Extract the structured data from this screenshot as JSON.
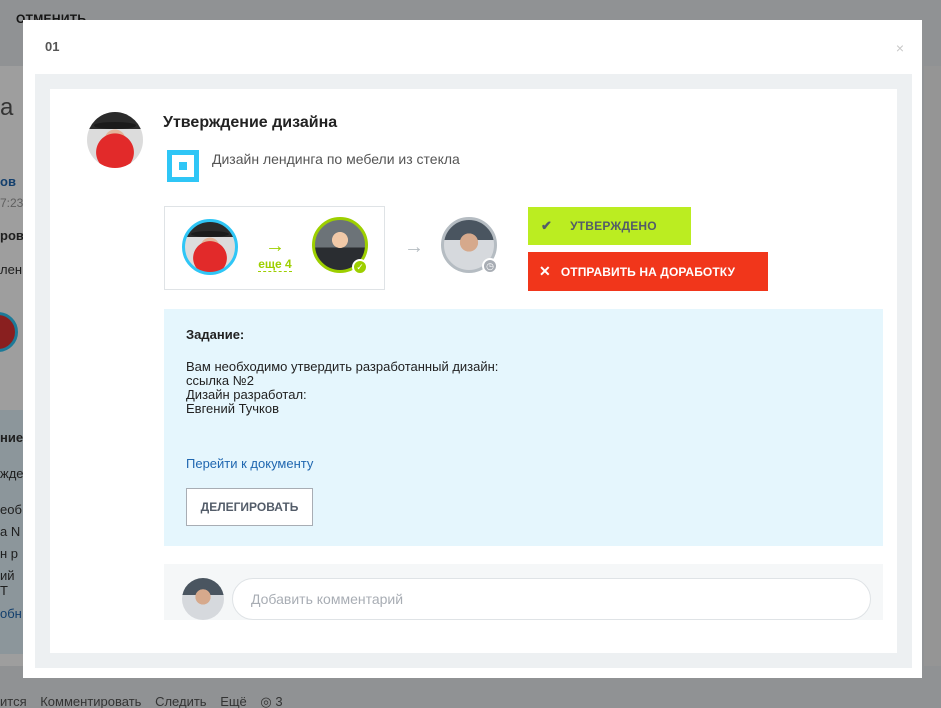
{
  "background": {
    "top_text": "ОТМЕНИТЬ",
    "left_fragments": [
      "а",
      "ов",
      "7:23",
      "ров",
      "лен",
      "ние",
      "жде",
      "еоб",
      "а N",
      "н р",
      "ий Т",
      "обн"
    ],
    "bottom_actions": [
      "ится",
      "Комментировать",
      "Следить",
      "Ещё",
      "◎ 3"
    ]
  },
  "modal": {
    "id": "01",
    "close_symbol": "×"
  },
  "task": {
    "title": "Утверждение дизайна",
    "project_name": "Дизайн лендинга по мебели из стекла"
  },
  "flow": {
    "arrow_symbol": "→",
    "more_label": "еще 4",
    "approved_badge": "✓",
    "pending_badge": "◷"
  },
  "actions": {
    "approved_label": "УТВЕРЖДЕНО",
    "approved_icon": "✔",
    "rework_label": "ОТПРАВИТЬ НА ДОРАБОТКУ",
    "rework_icon": "✕"
  },
  "assignment": {
    "label": "Задание:",
    "lines": [
      "Вам необходимо утвердить разработанный дизайн:",
      "ссылка №2",
      "Дизайн разработал:",
      "Евгений Тучков"
    ],
    "link_label": "Перейти к документу",
    "delegate_label": "ДЕЛЕГИРОВАТЬ"
  },
  "comment": {
    "placeholder": "Добавить комментарий"
  },
  "colors": {
    "accent_blue": "#2fc6f6",
    "accent_green": "#bbed21",
    "accent_red": "#f1361b",
    "task_bg": "#e5f6fd"
  }
}
